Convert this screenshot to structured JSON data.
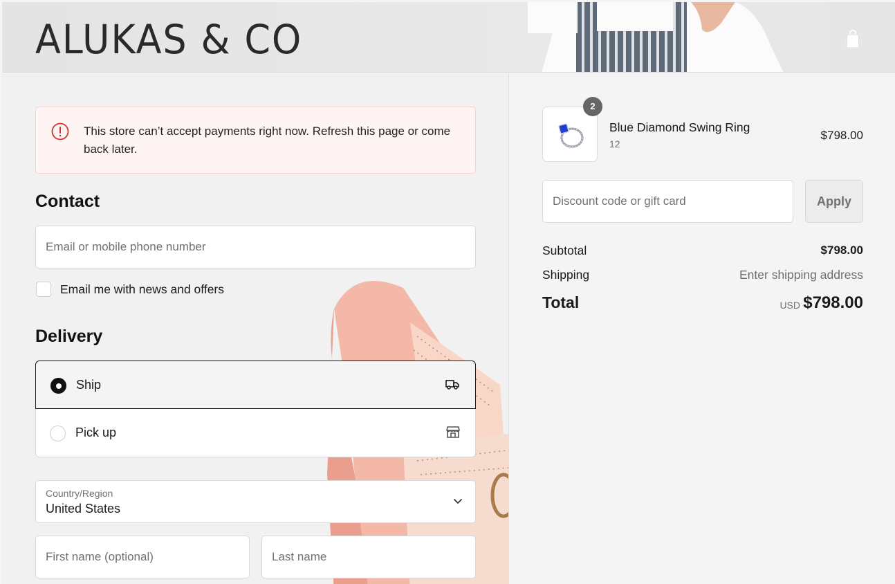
{
  "header": {
    "logo": "ALUKAS & CO",
    "cart_icon": "shopping-bag-icon"
  },
  "alert": {
    "icon": "error-circle-icon",
    "message": "This store can’t accept payments right now. Refresh this page or come back later."
  },
  "contact": {
    "title": "Contact",
    "email_placeholder": "Email or mobile phone number",
    "newsletter_label": "Email me with news and offers",
    "newsletter_checked": false
  },
  "delivery": {
    "title": "Delivery",
    "options": [
      {
        "label": "Ship",
        "icon": "truck-icon",
        "selected": true
      },
      {
        "label": "Pick up",
        "icon": "store-icon",
        "selected": false
      }
    ],
    "country_label": "Country/Region",
    "country_value": "United States",
    "first_name_placeholder": "First name (optional)",
    "last_name_placeholder": "Last name"
  },
  "order": {
    "item": {
      "quantity": "2",
      "name": "Blue Diamond Swing Ring",
      "variant": "12",
      "price": "$798.00"
    },
    "discount_placeholder": "Discount code or gift card",
    "apply_label": "Apply",
    "subtotal_label": "Subtotal",
    "subtotal_value": "$798.00",
    "shipping_label": "Shipping",
    "shipping_value": "Enter shipping address",
    "total_label": "Total",
    "currency": "USD",
    "total_value": "$798.00"
  },
  "colors": {
    "alert_bg": "#fff4f4",
    "alert_icon": "#d0312d",
    "selected_border": "#1a1a1a"
  }
}
